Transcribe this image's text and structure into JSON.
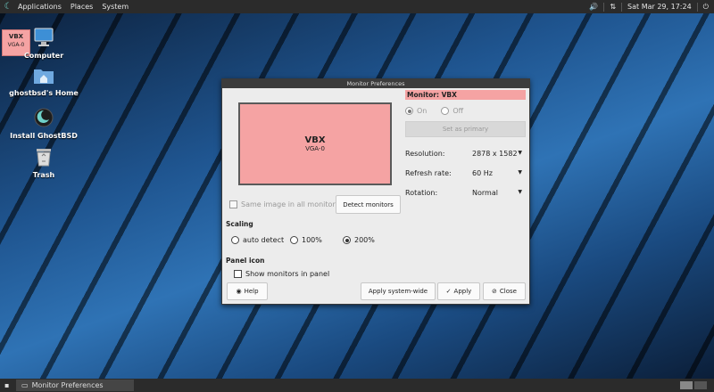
{
  "top_panel": {
    "menus": [
      "Applications",
      "Places",
      "System"
    ],
    "datetime": "Sat Mar 29, 17:24",
    "icons": [
      "speaker-icon",
      "network-icon",
      "power-icon"
    ]
  },
  "desktop": {
    "vbx_thumb": {
      "name": "VBX",
      "output": "VGA-0"
    },
    "icons": [
      {
        "label": "Computer",
        "icon": "computer-icon"
      },
      {
        "label": "ghostbsd's Home",
        "icon": "home-folder-icon"
      },
      {
        "label": "Install GhostBSD",
        "icon": "ghostbsd-icon"
      },
      {
        "label": "Trash",
        "icon": "trash-icon"
      }
    ]
  },
  "dialog": {
    "title": "Monitor Preferences",
    "preview": {
      "name": "VBX",
      "output": "VGA-0"
    },
    "monitor_header": "Monitor: VBX",
    "on_label": "On",
    "off_label": "Off",
    "set_primary_label": "Set as primary",
    "resolution_label": "Resolution:",
    "resolution_value": "2878 x 1582",
    "refresh_label": "Refresh rate:",
    "refresh_value": "60 Hz",
    "rotation_label": "Rotation:",
    "rotation_value": "Normal",
    "same_image_label": "Same image in all monitors",
    "detect_label": "Detect monitors",
    "scaling_title": "Scaling",
    "scaling_options": [
      "auto detect",
      "100%",
      "200%"
    ],
    "scaling_selected": "200%",
    "panel_icon_title": "Panel icon",
    "show_monitors_label": "Show monitors in panel",
    "help_label": "Help",
    "apply_system_label": "Apply system-wide",
    "apply_label": "Apply",
    "close_label": "Close"
  },
  "bottom_panel": {
    "task_label": "Monitor Preferences"
  },
  "colors": {
    "monitor_pink": "#f5a3a3",
    "panel_bg": "#2b2b2b"
  }
}
